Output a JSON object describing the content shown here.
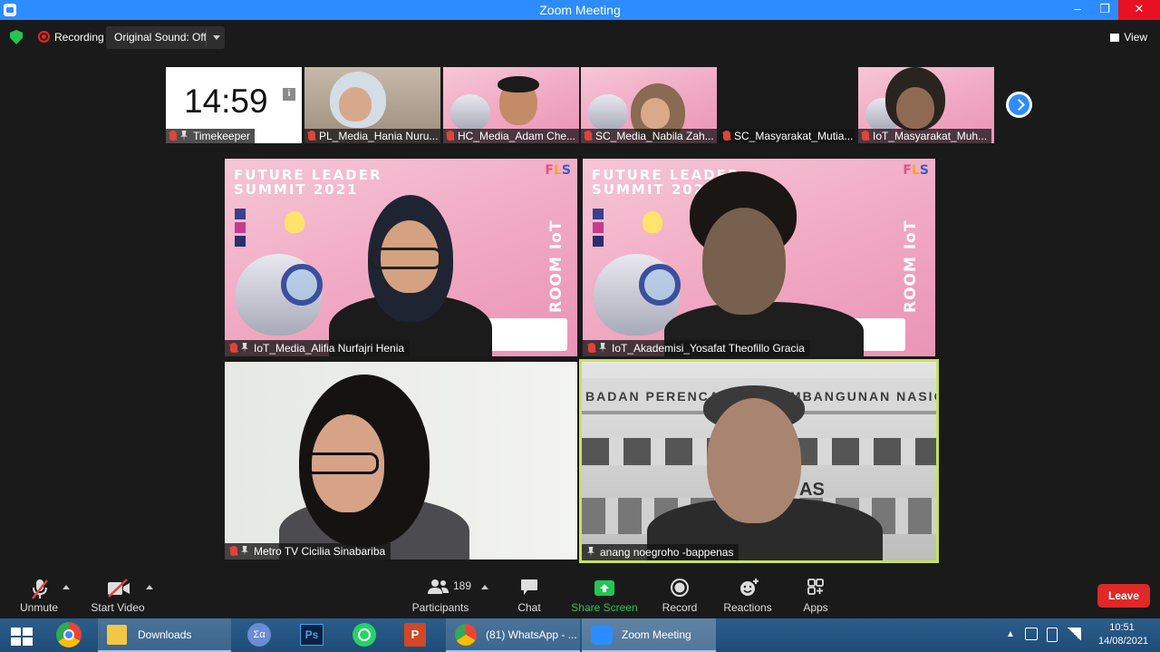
{
  "window": {
    "title": "Zoom Meeting",
    "min": "–",
    "max": "❐",
    "close": "✕"
  },
  "topbar": {
    "recording_label": "Recording",
    "original_sound": "Original Sound: Off",
    "view_label": "View"
  },
  "thumbnails": [
    {
      "name": "Timekeeper",
      "clock": "14:59",
      "info": "i"
    },
    {
      "name": "PL_Media_Hania Nuru..."
    },
    {
      "name": "HC_Media_Adam Che..."
    },
    {
      "name": "SC_Media_Nabila Zah..."
    },
    {
      "name": "SC_Masyarakat_Mutia..."
    },
    {
      "name": "IoT_Masyarakat_Muh..."
    }
  ],
  "tiles": [
    {
      "name": "IoT_Media_Alifia Nurfajri Henia",
      "bg_title": "FUTURE LEADER\nSUMMIT 2021",
      "room": "ROOM IoT",
      "logo": "FLS"
    },
    {
      "name": "IoT_Akademisi_Yosafat Theofillo Gracia",
      "bg_title": "FUTURE LEADER\nSUMMIT 2021",
      "room": "ROOM IoT",
      "logo": "FLS"
    },
    {
      "name": "Metro TV Cicilia Sinabariba"
    },
    {
      "name": "anang noegroho -bappenas",
      "building_sign": "BADAN PERENCANAAN PEMBANGUNAN NASIONAL",
      "building_sign_2": "AS"
    }
  ],
  "toolbar": {
    "unmute": "Unmute",
    "start_video": "Start Video",
    "participants": "Participants",
    "participants_count": "189",
    "chat": "Chat",
    "share_screen": "Share Screen",
    "record": "Record",
    "reactions": "Reactions",
    "apps": "Apps",
    "leave": "Leave"
  },
  "taskbar": {
    "items": [
      {
        "label": "Downloads"
      },
      {
        "label": "(81) WhatsApp - ..."
      },
      {
        "label": "Zoom Meeting"
      }
    ],
    "time": "10:51",
    "date": "14/08/2021"
  },
  "colors": {
    "accent": "#2d8cff",
    "leave": "#e02828",
    "share": "#23c553",
    "active_speaker": "#c7e25c"
  }
}
